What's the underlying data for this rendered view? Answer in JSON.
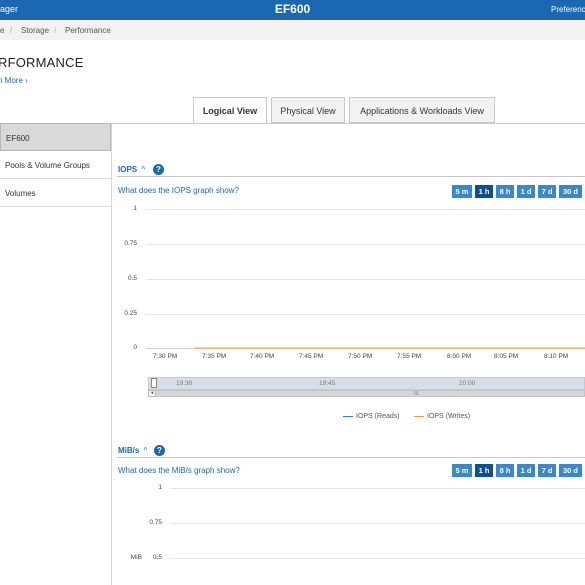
{
  "topbar": {
    "app_name": "ager",
    "title": "EF600",
    "preferences": "Preference"
  },
  "breadcrumb": {
    "items": [
      "e",
      "Storage",
      "Performance"
    ],
    "separator": "/"
  },
  "page": {
    "title": "RFORMANCE",
    "learn_more": "n More ›"
  },
  "tabs": [
    {
      "label": "Logical View",
      "active": true
    },
    {
      "label": "Physical View",
      "active": false
    },
    {
      "label": "Applications & Workloads View",
      "active": false
    }
  ],
  "sidebar": {
    "items": [
      {
        "label": "EF600",
        "active": true
      },
      {
        "label": "Pools & Volume Groups",
        "active": false
      },
      {
        "label": "Volumes",
        "active": false
      }
    ]
  },
  "iops": {
    "heading": "IOPS",
    "caret": "^",
    "help": "?",
    "link": "What does the IOPS graph show?",
    "time_buttons": [
      "5 m",
      "1 h",
      "8 h",
      "1 d",
      "7 d",
      "30 d"
    ],
    "selected_range": "1 h",
    "y_ticks": [
      "1",
      "0.75",
      "0.5",
      "0.25",
      "0"
    ],
    "x_ticks": [
      "7:30 PM",
      "7:35 PM",
      "7:40 PM",
      "7:45 PM",
      "7:50 PM",
      "7:55 PM",
      "8:00 PM",
      "8:05 PM",
      "8:10 PM"
    ],
    "navigator_labels": [
      "19:30",
      "19:45",
      "20:00"
    ],
    "scroll_grip": "III",
    "legend": [
      {
        "name": "IOPS (Reads)",
        "color": "#2f7ed8"
      },
      {
        "name": "IOPS (Writes)",
        "color": "#f0a030"
      }
    ]
  },
  "mibs": {
    "heading": "MiB/s",
    "caret": "^",
    "help": "?",
    "link": "What does the MiB/s graph show?",
    "time_buttons": [
      "5 m",
      "1 h",
      "8 h",
      "1 d",
      "7 d",
      "30 d"
    ],
    "selected_range": "1 h",
    "y_ticks": [
      "1",
      "0.75",
      "0.5"
    ],
    "unit_label": "MiB"
  },
  "chart_data": [
    {
      "type": "line",
      "title": "IOPS",
      "ylim": [
        0,
        1
      ],
      "x": [
        "7:30 PM",
        "7:35 PM",
        "7:40 PM",
        "7:45 PM",
        "7:50 PM",
        "7:55 PM",
        "8:00 PM",
        "8:05 PM",
        "8:10 PM"
      ],
      "series": [
        {
          "name": "IOPS (Reads)",
          "values": [
            0,
            0,
            0,
            0,
            0,
            0,
            0,
            0,
            0
          ]
        },
        {
          "name": "IOPS (Writes)",
          "values": [
            0,
            0,
            0,
            0,
            0,
            0,
            0,
            0,
            0
          ]
        }
      ]
    },
    {
      "type": "line",
      "title": "MiB/s",
      "ylabel": "MiB",
      "ylim": [
        0.5,
        1
      ]
    }
  ]
}
